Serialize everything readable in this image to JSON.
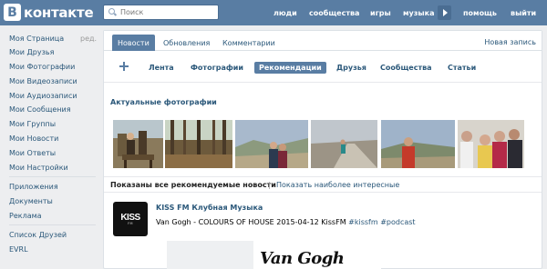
{
  "header": {
    "logo_letter": "В",
    "logo_text": "контакте",
    "search_placeholder": "Поиск",
    "nav": [
      "люди",
      "сообщества",
      "игры",
      "музыка",
      "помощь",
      "выйти"
    ]
  },
  "sidebar": {
    "edit_label": "ред.",
    "items": [
      "Моя Страница",
      "Мои Друзья",
      "Мои Фотографии",
      "Мои Видеозаписи",
      "Мои Аудиозаписи",
      "Мои Сообщения",
      "Мои Группы",
      "Мои Новости",
      "Мои Ответы",
      "Мои Настройки"
    ],
    "extra_items": [
      "Приложения",
      "Документы",
      "Реклама"
    ],
    "bottom_items": [
      "Список Друзей",
      "EVRL"
    ]
  },
  "tabs": {
    "items": [
      "Новости",
      "Обновления",
      "Комментарии"
    ],
    "active_index": 0,
    "new_post": "Новая запись"
  },
  "filters": {
    "items": [
      "Лента",
      "Фотографии",
      "Рекомендации",
      "Друзья",
      "Сообщества",
      "Статьи"
    ],
    "active_index": 2
  },
  "photos": {
    "title": "Актуальные фотографии"
  },
  "recommendations": {
    "bold_text": "Показаны все рекомендуемые новости",
    "separator": "|",
    "link_text": "Показать наиболее интересные"
  },
  "post": {
    "avatar_logo": "KISS",
    "avatar_sub": "FM",
    "author": "KISS FM Клубная Музыка",
    "text_main": "Van Gogh - COLOURS OF HOUSE 2015-04-12 KissFM ",
    "tag1": "#kissfm",
    "tag2": "#podcast",
    "image_title": "Van Gogh"
  },
  "colors": {
    "header_bg": "#597da3",
    "link": "#2b587a",
    "page_bg": "#edeef0"
  }
}
